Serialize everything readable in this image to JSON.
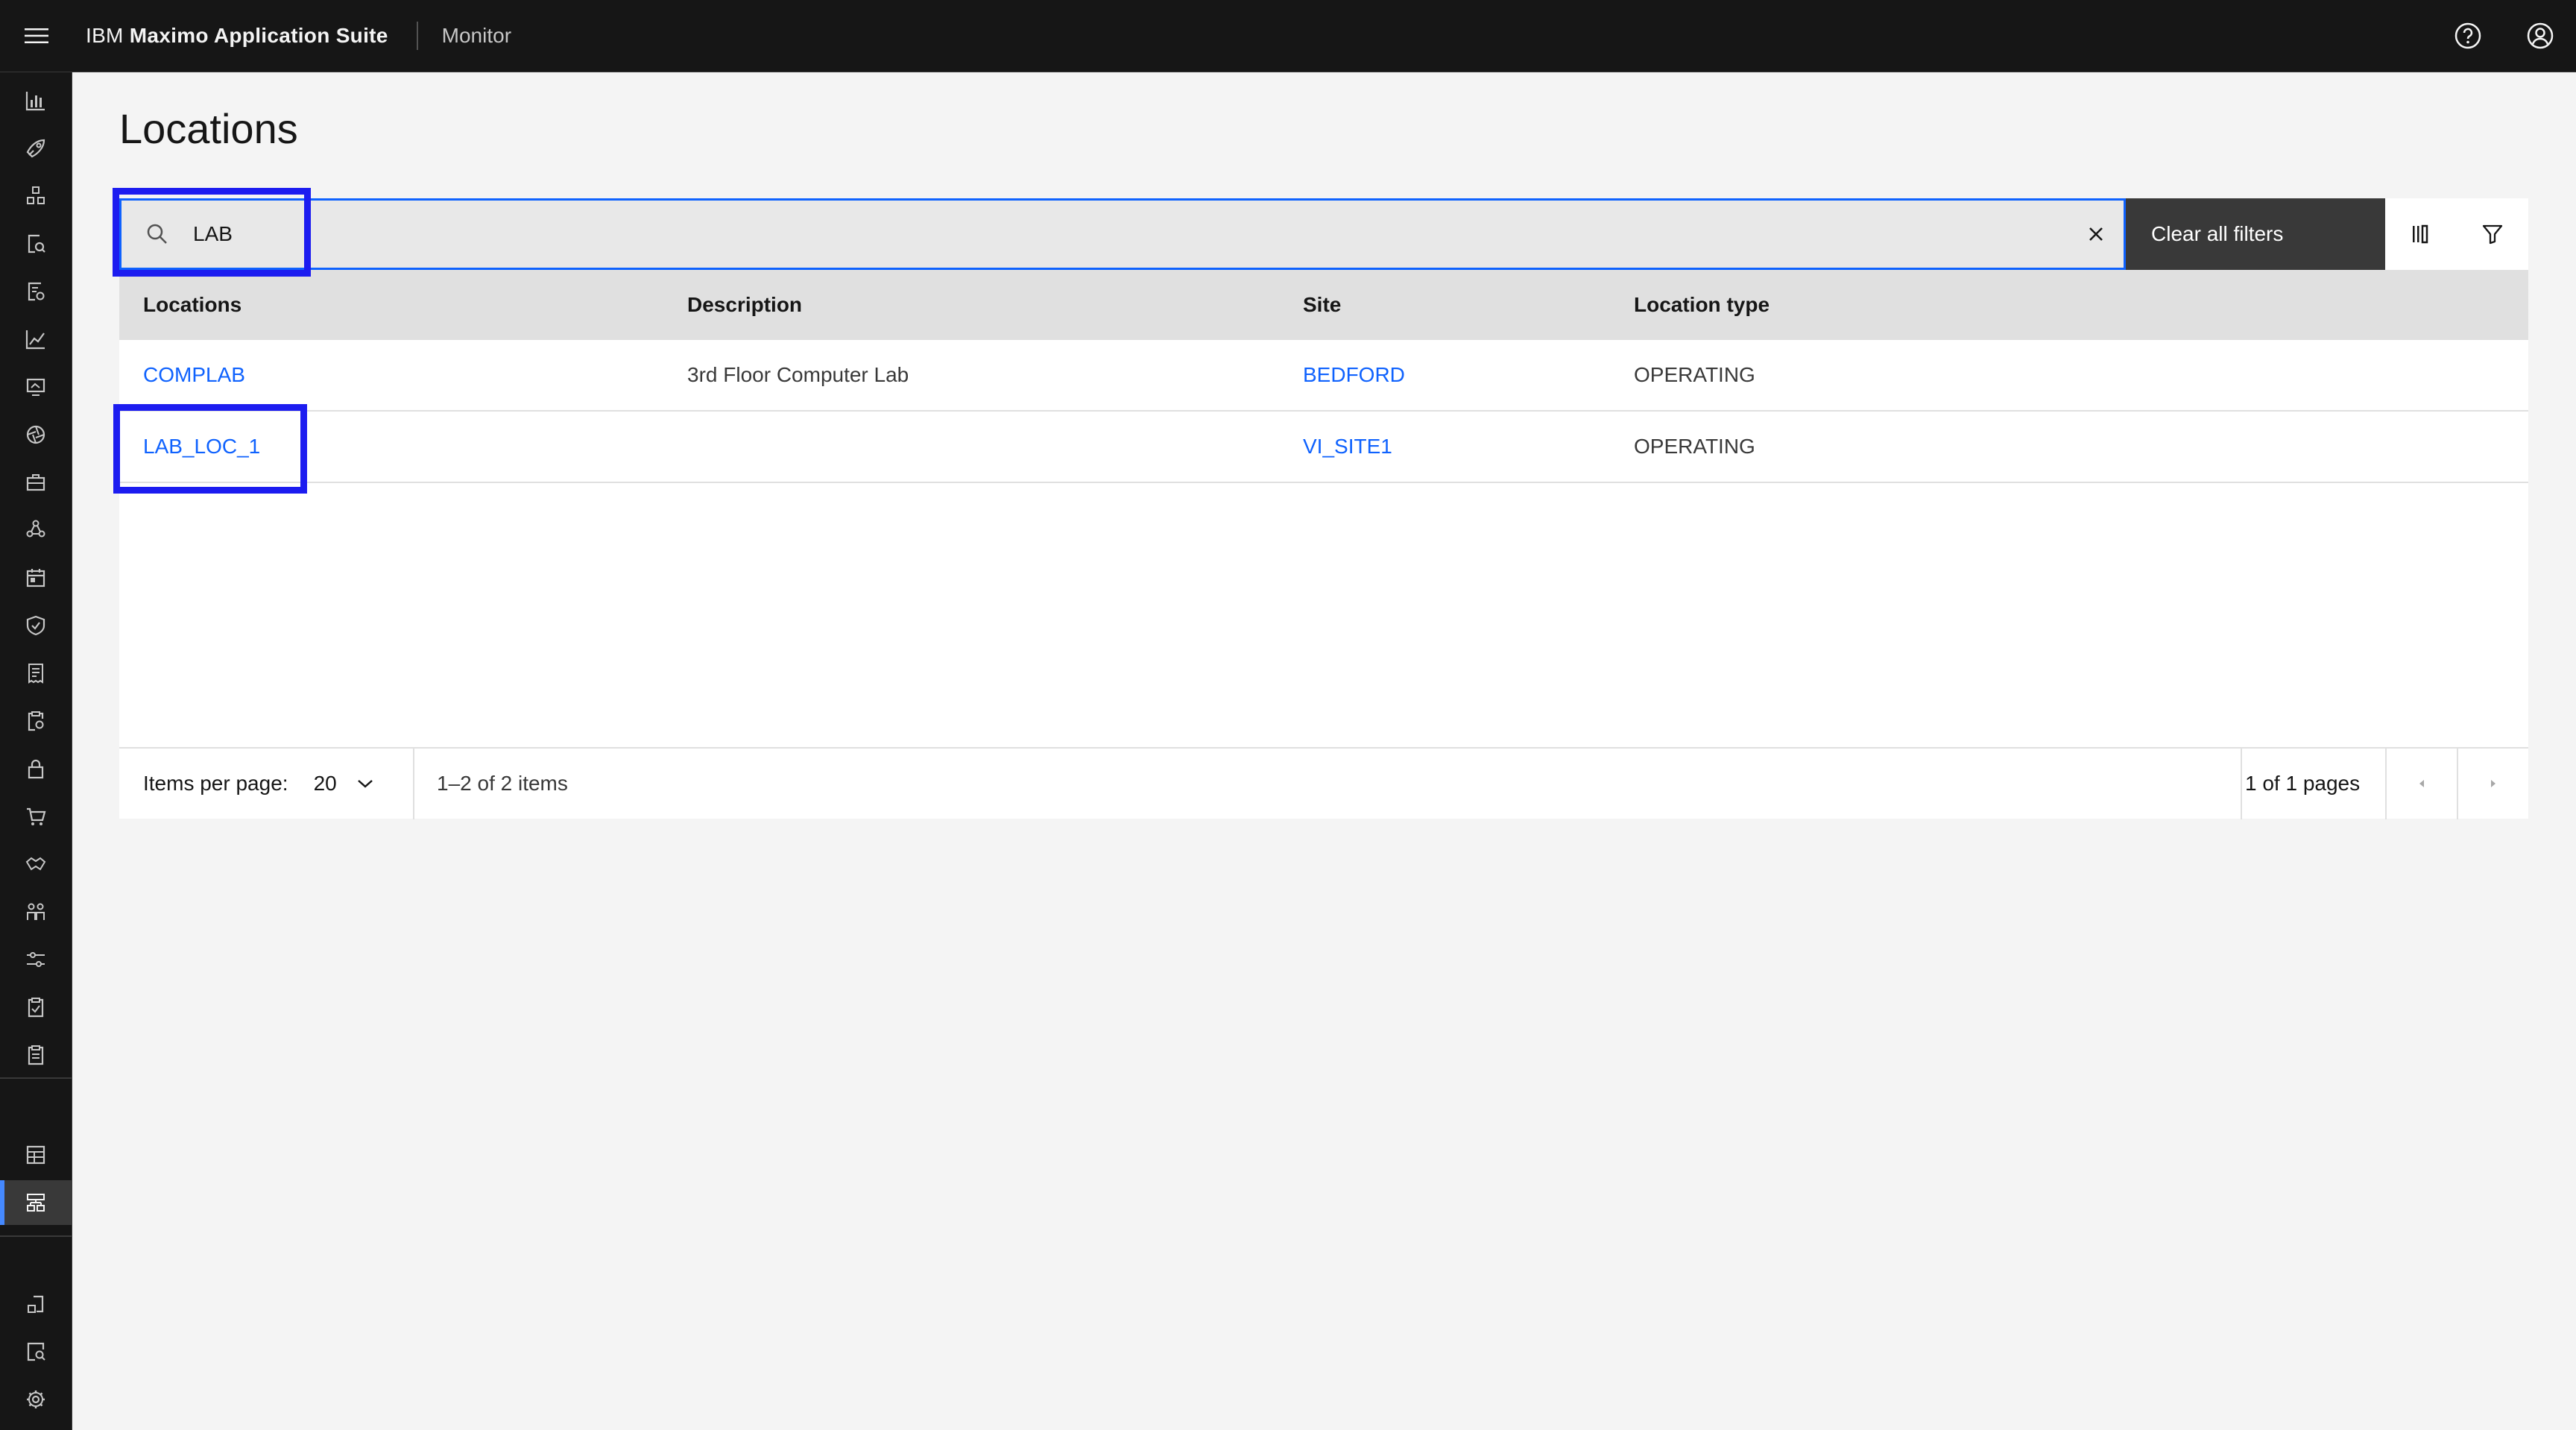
{
  "header": {
    "brand_prefix": "IBM",
    "brand_name": "Maximo Application Suite",
    "app_name": "Monitor"
  },
  "page": {
    "title": "Locations"
  },
  "search": {
    "value": "LAB",
    "placeholder": ""
  },
  "toolbar": {
    "clear_all_label": "Clear all filters"
  },
  "table": {
    "columns": [
      "Locations",
      "Description",
      "Site",
      "Location type"
    ],
    "rows": [
      {
        "location": "COMPLAB",
        "description": "3rd Floor Computer Lab",
        "site": "BEDFORD",
        "type": "OPERATING"
      },
      {
        "location": "LAB_LOC_1",
        "description": "",
        "site": "VI_SITE1",
        "type": "OPERATING"
      }
    ]
  },
  "pagination": {
    "items_per_page_label": "Items per page:",
    "items_per_page": "20",
    "range": "1–2 of 2 items",
    "pages": "1 of 1 pages"
  },
  "colors": {
    "accent": "#0f62fe",
    "highlight": "#1c1cf0",
    "header_bg": "#161616"
  }
}
